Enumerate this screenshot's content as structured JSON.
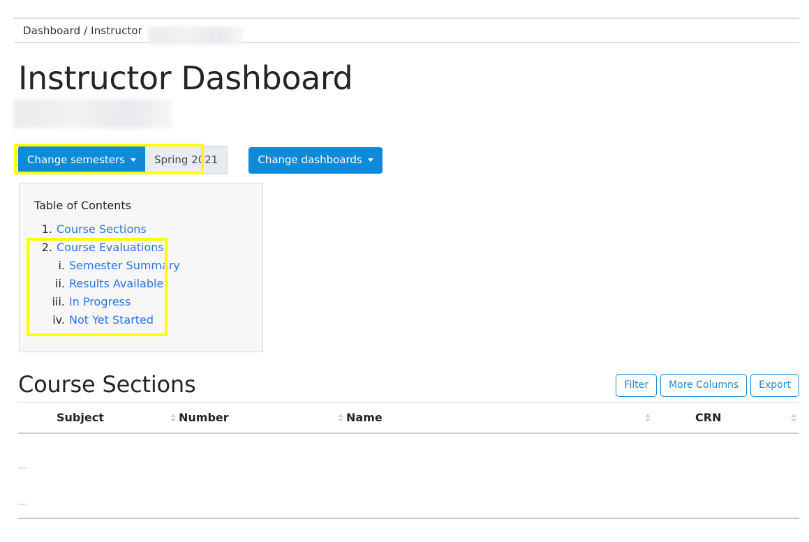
{
  "breadcrumb": {
    "text": "Dashboard / Instructor",
    "redacted_suffix": ""
  },
  "header": {
    "title": "Instructor Dashboard",
    "subtitle_redacted": ""
  },
  "toolbar": {
    "change_semesters_label": "Change semesters",
    "semester_value": "Spring 2021",
    "change_dashboards_label": "Change dashboards"
  },
  "toc": {
    "title": "Table of Contents",
    "items": [
      {
        "marker": "1.",
        "label": "Course Sections",
        "level": 1
      },
      {
        "marker": "2.",
        "label": "Course Evaluations",
        "level": 1
      },
      {
        "marker": "i.",
        "label": "Semester Summary",
        "level": 2
      },
      {
        "marker": "ii.",
        "label": "Results Available",
        "level": 2
      },
      {
        "marker": "iii.",
        "label": "In Progress",
        "level": 2
      },
      {
        "marker": "iv.",
        "label": "Not Yet Started",
        "level": 2
      }
    ]
  },
  "course_sections": {
    "title": "Course Sections",
    "actions": [
      {
        "label": "Filter"
      },
      {
        "label": "More Columns"
      },
      {
        "label": "Export"
      }
    ],
    "columns": [
      {
        "label": "Subject",
        "sortable": true
      },
      {
        "label": "Number",
        "sortable": true
      },
      {
        "label": "Name",
        "sortable": true
      },
      {
        "label": "CRN",
        "sortable": true
      }
    ],
    "rows": [
      {
        "subject": "",
        "number": "",
        "name": "",
        "crn": "",
        "redacted": true
      },
      {
        "subject": "",
        "number": "",
        "name": "",
        "crn": "",
        "redacted": true
      }
    ]
  },
  "colors": {
    "primary_blue": "#0d8bd9",
    "link_blue": "#2a74e0",
    "outline_blue": "#1b8bd0",
    "highlight_yellow": "#ffff00",
    "badge_bg": "#e9ecef",
    "card_bg": "#f7f7f7"
  }
}
